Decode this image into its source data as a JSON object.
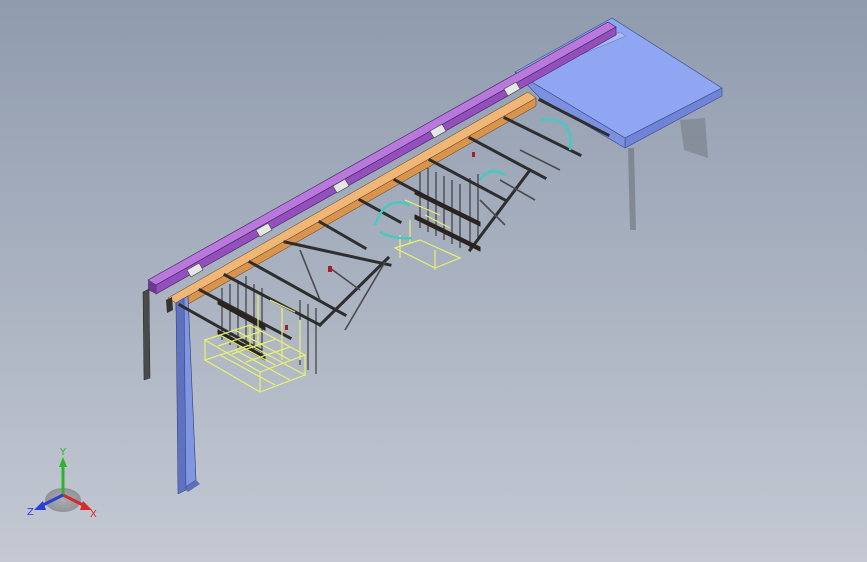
{
  "viewport": {
    "background_top": "#8f9bae",
    "background_bottom": "#c4c9d3"
  },
  "model": {
    "colors": {
      "top_beam": "#a35fc9",
      "wood_beam": "#e6a35f",
      "platform_top": "#8fa6f2",
      "platform_side": "#6f84d6",
      "column": "#7f92d9",
      "steel": "#3a3a3a",
      "cage": "#e8f070",
      "cyan_arc": "#45c9c1",
      "panel": "#2b2420"
    }
  },
  "triad": {
    "y_label": "Y",
    "x_label": "X",
    "z_label": "Z",
    "y_color": "#2bb52b",
    "x_color": "#d42a2a",
    "z_color": "#2a3fd4"
  }
}
